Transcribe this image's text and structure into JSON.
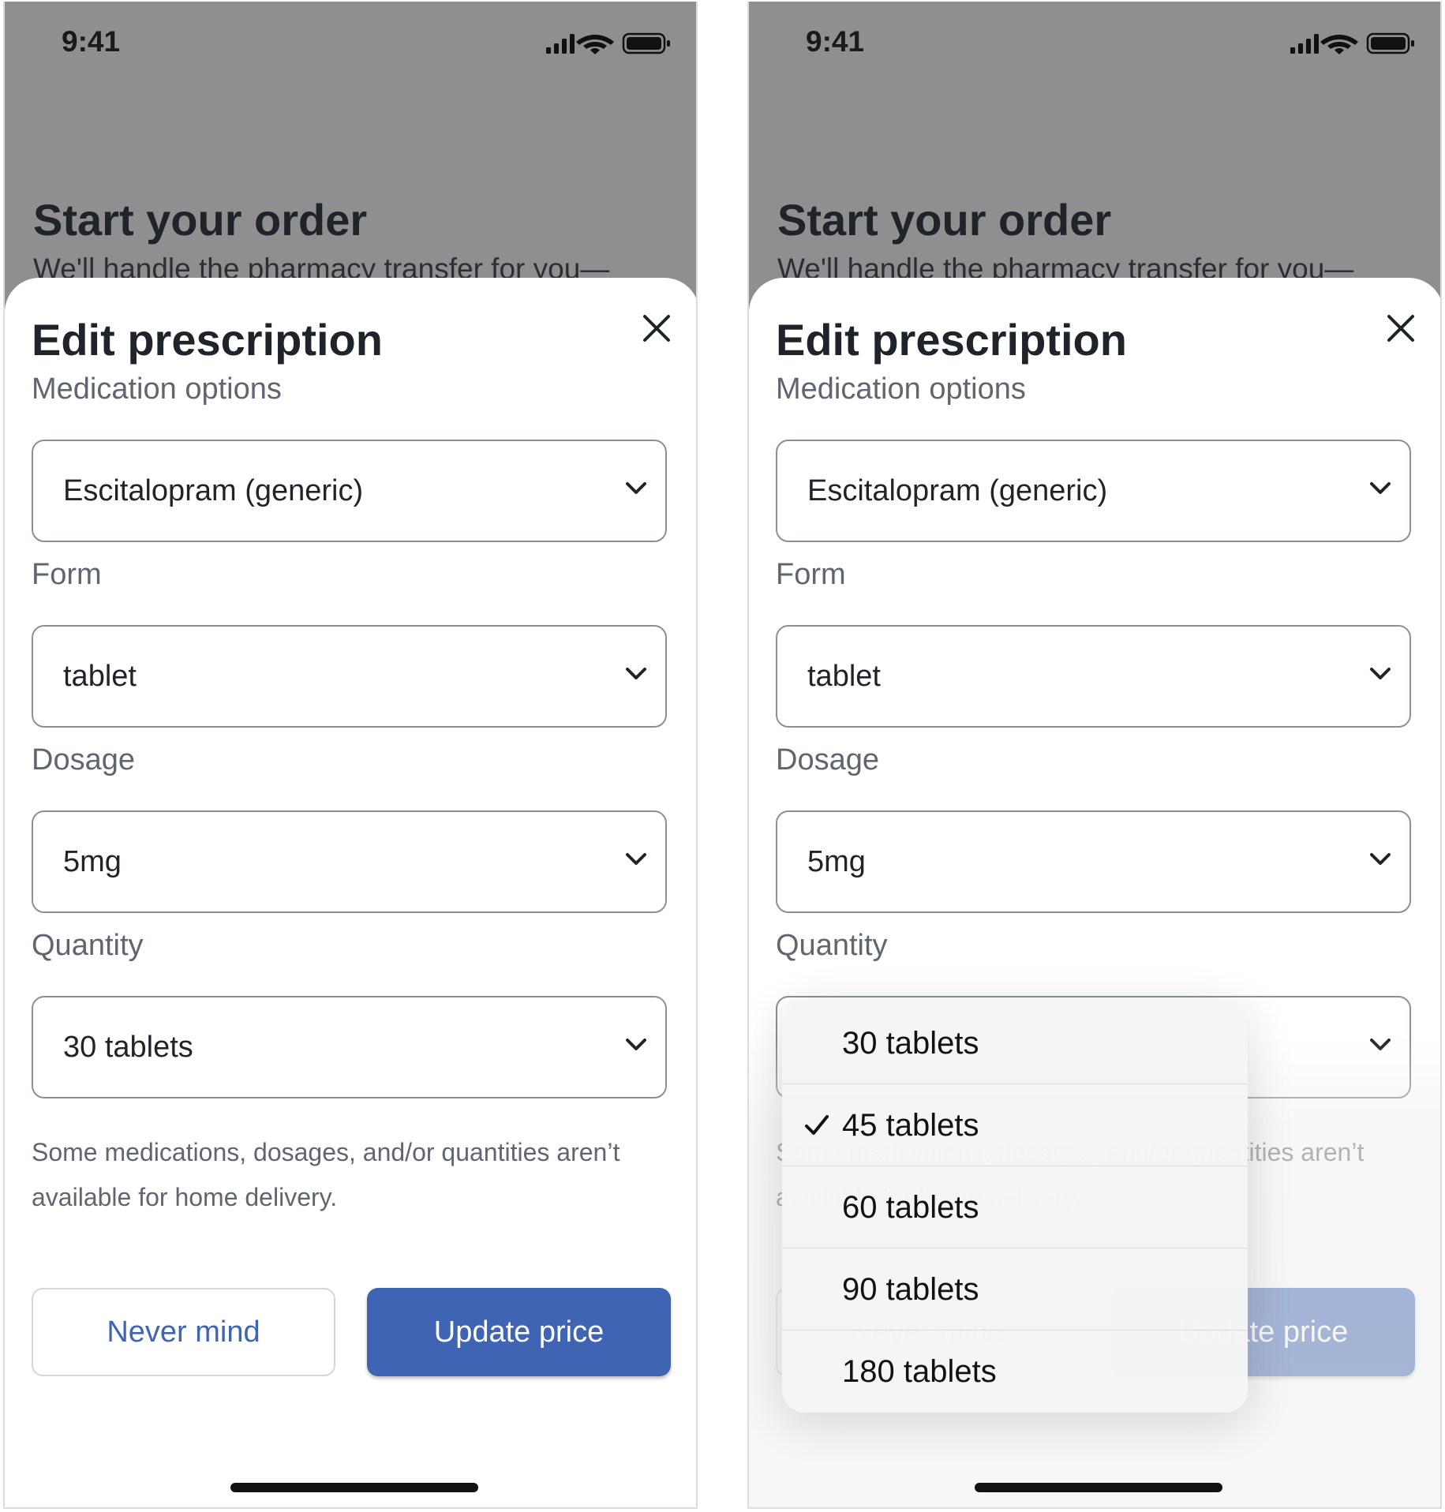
{
  "status_bar": {
    "time": "9:41"
  },
  "background_page": {
    "title": "Start your order",
    "subtitle": "We'll handle the pharmacy transfer for you—"
  },
  "sheet": {
    "title": "Edit prescription",
    "fields": [
      {
        "label": "Medication options",
        "value": "Escitalopram (generic)"
      },
      {
        "label": "Form",
        "value": "tablet"
      },
      {
        "label": "Dosage",
        "value": "5mg"
      },
      {
        "label": "Quantity",
        "value": "30 tablets"
      }
    ],
    "note": "Some medications, dosages, and/or quantities aren’t available for home delivery.",
    "never_mind_label": "Never mind",
    "update_price_label": "Update price"
  },
  "quantity_menu": {
    "selected": "45 tablets",
    "options": [
      {
        "label": "30 tablets"
      },
      {
        "label": "45 tablets"
      },
      {
        "label": "60 tablets"
      },
      {
        "label": "90 tablets"
      },
      {
        "label": "180 tablets"
      }
    ]
  },
  "colors": {
    "primary": "#3e64b3",
    "backdrop": "#8f8f8f",
    "text": "#1f242b",
    "muted_text": "#5f6670"
  }
}
